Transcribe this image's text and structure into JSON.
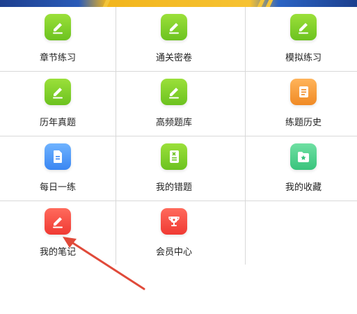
{
  "colors": {
    "green": "#7ccf28",
    "orange": "#f5a03a",
    "blue": "#4a95f7",
    "teal": "#4dcf8c",
    "red": "#f24a3f",
    "divider": "#d8d8d8",
    "annotation_arrow": "#e04a3a"
  },
  "menu": {
    "items": [
      {
        "label": "章节练习",
        "icon": "pencil-icon",
        "color": "green"
      },
      {
        "label": "通关密卷",
        "icon": "pencil-icon",
        "color": "green"
      },
      {
        "label": "模拟练习",
        "icon": "pencil-icon",
        "color": "green"
      },
      {
        "label": "历年真题",
        "icon": "pencil-icon",
        "color": "green"
      },
      {
        "label": "高频题库",
        "icon": "pencil-icon",
        "color": "green"
      },
      {
        "label": "练题历史",
        "icon": "history-list-icon",
        "color": "orange"
      },
      {
        "label": "每日一练",
        "icon": "document-icon",
        "color": "blue"
      },
      {
        "label": "我的错题",
        "icon": "wrong-question-book-icon",
        "color": "green"
      },
      {
        "label": "我的收藏",
        "icon": "star-folder-icon",
        "color": "teal"
      },
      {
        "label": "我的笔记",
        "icon": "pencil-icon",
        "color": "red"
      },
      {
        "label": "会员中心",
        "icon": "trophy-icon",
        "color": "red"
      }
    ]
  }
}
